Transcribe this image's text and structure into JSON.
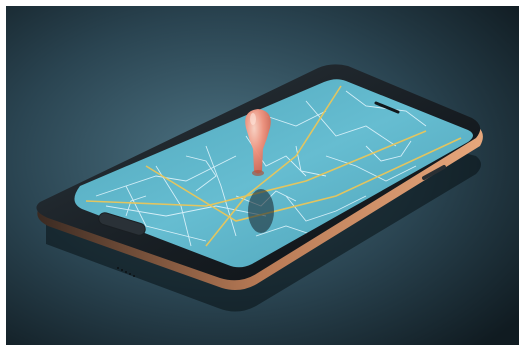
{
  "scene": {
    "subject": "smartphone",
    "screen_content": "map",
    "marker_icon": "map-pin-icon",
    "colors": {
      "background_dark": "#14242c",
      "background_light": "#4a6f7d",
      "phone_body": "#1b2126",
      "phone_rim": "#c98e66",
      "screen": "#5fb7cc",
      "map_lines": "#e8f8ff",
      "map_roads": "#e9c65a",
      "pin": "#f08a76"
    }
  }
}
